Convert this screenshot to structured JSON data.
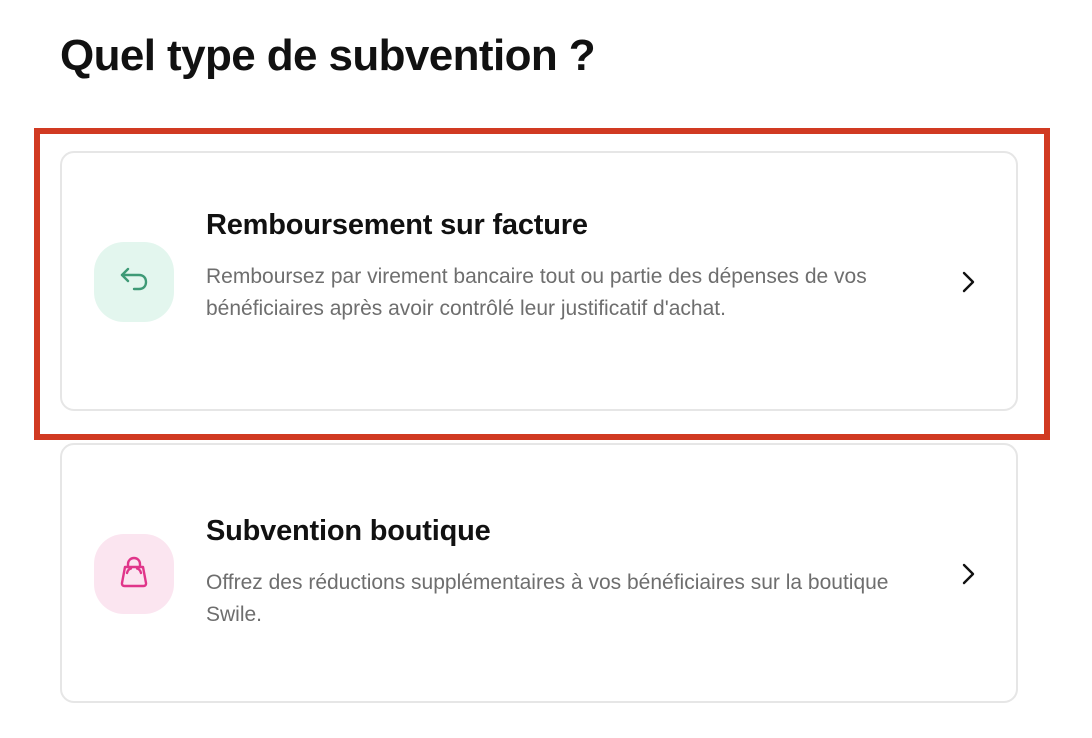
{
  "page": {
    "title": "Quel type de subvention ?"
  },
  "options": [
    {
      "title": "Remboursement sur facture",
      "description": "Remboursez par virement bancaire tout ou partie des dépenses de vos bénéficiaires après avoir contrôlé leur justificatif d'achat.",
      "icon": "return-arrow-icon",
      "icon_color": "#3e9a76",
      "tile_color": "#e3f6ee",
      "highlighted": true
    },
    {
      "title": "Subvention boutique",
      "description": "Offrez des réductions supplémentaires à vos bénéficiaires sur la boutique Swile.",
      "icon": "shopping-bag-icon",
      "icon_color": "#e0358a",
      "tile_color": "#fbe5f0",
      "highlighted": false
    }
  ],
  "colors": {
    "highlight_border": "#d13a22",
    "card_border": "#e6e6e6"
  }
}
